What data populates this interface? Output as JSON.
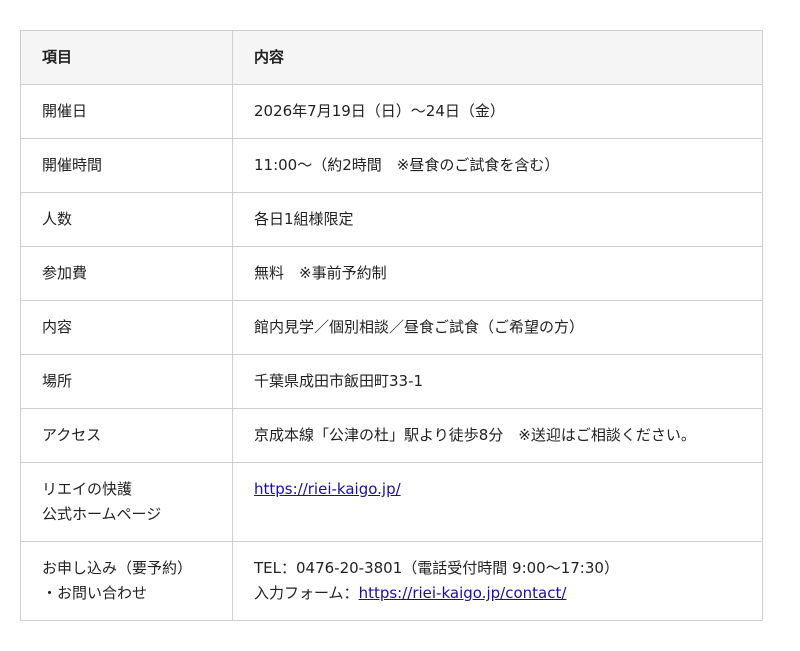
{
  "table": {
    "header": {
      "item": "項目",
      "content": "内容"
    },
    "rows": [
      {
        "label": "開催日",
        "value": "2026年7月19日（日）〜24日（金）"
      },
      {
        "label": "開催時間",
        "value": "11:00〜（約2時間　※昼食のご試食を含む）"
      },
      {
        "label": "人数",
        "value": "各日1組様限定"
      },
      {
        "label": "参加費",
        "value": "無料　※事前予約制"
      },
      {
        "label": "内容",
        "value": "館内見学／個別相談／昼食ご試食（ご希望の方）"
      },
      {
        "label": "場所",
        "value": "千葉県成田市飯田町33-1"
      },
      {
        "label": "アクセス",
        "value": "京成本線「公津の杜」駅より徒歩8分　※送迎はご相談ください。"
      },
      {
        "label_line1": "リエイの快護",
        "label_line2": "公式ホームページ",
        "link": "https://riei-kaigo.jp/"
      },
      {
        "label_line1": "お申し込み（要予約）",
        "label_line2": "・お問い合わせ",
        "tel": "TEL：0476-20-3801（電話受付時間 9:00〜17:30）",
        "form_prefix": "入力フォーム：",
        "form_link": "https://riei-kaigo.jp/contact/"
      }
    ]
  }
}
